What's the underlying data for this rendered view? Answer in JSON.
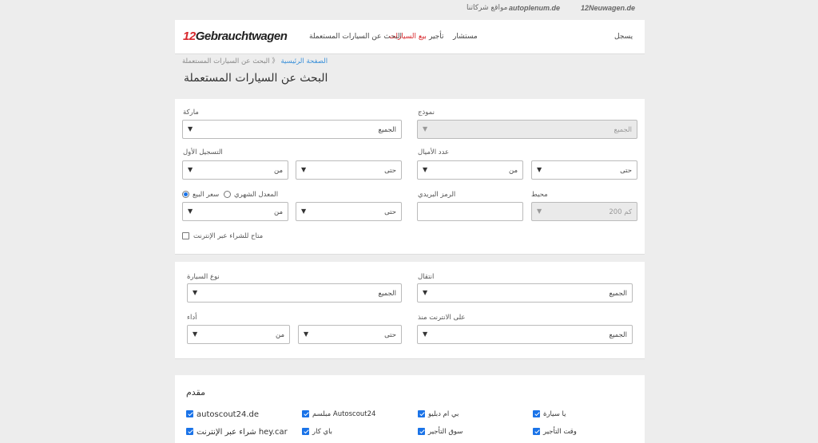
{
  "topbar": {
    "group_sites": "مواقع شركاتنا",
    "autoplenum": "autoplenum.de",
    "neuwagen": "12Neuwagen.de"
  },
  "header": {
    "brand_num": "12",
    "brand_text": "Gebrauchtwagen",
    "nav": [
      "البحث عن السيارات المستعملة",
      "بيع السيارات",
      "تأجير",
      "مستشار"
    ],
    "login": "يسجل"
  },
  "breadcrumb": {
    "home": "الصفحة الرئيسية",
    "separator": "《",
    "current": "البحث عن السيارات المستعملة"
  },
  "page_title": "البحث عن السيارات المستعملة",
  "filters": {
    "make": {
      "label": "ماركة",
      "value": "الجميع"
    },
    "model": {
      "label": "نموذج",
      "value": "الجميع"
    },
    "first_registration": {
      "label": "التسجيل الأول",
      "from": "من",
      "to": "حتى"
    },
    "mileage": {
      "label": "عدد الأميال",
      "from": "من",
      "to": "حتى"
    },
    "price_buy": "سعر البيع",
    "price_monthly": "المعدل الشهري",
    "price": {
      "from": "من",
      "to": "حتى"
    },
    "zip": {
      "label": "الرمز البريدي",
      "value": ""
    },
    "radius": {
      "label": "محيط",
      "value": "200 كم"
    },
    "online_buy": "متاح للشراء عبر الإنترنت"
  },
  "filters2": {
    "vehicle_type": {
      "label": "نوع السيارة",
      "value": "الجميع"
    },
    "transmission": {
      "label": "انتقال",
      "value": "الجميع"
    },
    "power": {
      "label": "أداء",
      "from": "من",
      "to": "حتى"
    },
    "online_since": {
      "label": "على الانترنت منذ",
      "value": "الجميع"
    }
  },
  "providers": {
    "title": "مقدم",
    "items": [
      [
        "autoscout24.de",
        "مبلسم Autoscout24",
        "بي ام دبليو",
        "يا سيارة"
      ],
      [
        "شراء عبر الإنترنت hey.car",
        "باي كار",
        "سوق التأجير",
        "وقت التأجير"
      ]
    ]
  },
  "colors": {
    "accent": "#d7272c",
    "link": "#3a90d9",
    "checkbox": "#1a73e8"
  }
}
